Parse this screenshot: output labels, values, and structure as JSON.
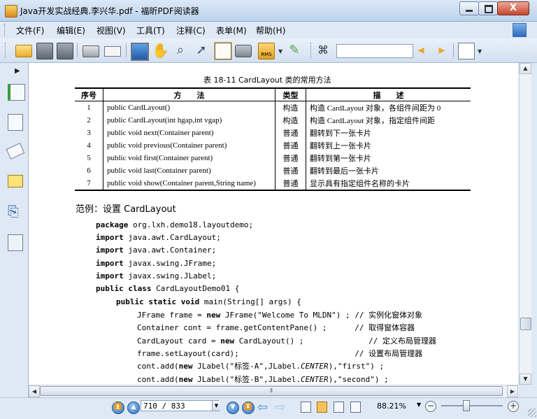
{
  "window": {
    "title": "Java开发实战经典.李兴华.pdf - 福昕PDF阅读器",
    "close_label": "X"
  },
  "menu": [
    "文件(F)",
    "编辑(E)",
    "视图(V)",
    "工具(T)",
    "注释(C)",
    "表单(M)",
    "帮助(H)"
  ],
  "toolbar": {
    "search_value": "",
    "icons": [
      "open-icon",
      "save-icon",
      "save-as-icon",
      "print-icon",
      "email-icon",
      "fullscreen-icon",
      "hand-tool-icon",
      "zoom-tool-icon",
      "select-arrow-icon",
      "text-select-icon",
      "snapshot-icon",
      "rms-icon",
      "sign-icon",
      "find-icon",
      "prev-result-icon",
      "next-result-icon",
      "doc-options-icon"
    ]
  },
  "document": {
    "table_caption": "表 18-11    CardLayout 类的常用方法",
    "table_headers": [
      "序号",
      "方　　法",
      "类型",
      "描　　述"
    ],
    "table_rows": [
      [
        "1",
        "public CardLayout()",
        "构造",
        "构造 CardLayout 对象，各组件间距为 0"
      ],
      [
        "2",
        "public CardLayout(int hgap,int vgap)",
        "构造",
        "构造 CardLayout 对象，指定组件间距"
      ],
      [
        "3",
        "public void next(Container parent)",
        "普通",
        "翻转到下一张卡片"
      ],
      [
        "4",
        "public void previous(Container parent)",
        "普通",
        "翻转到上一张卡片"
      ],
      [
        "5",
        "public void first(Container parent)",
        "普通",
        "翻转到第一张卡片"
      ],
      [
        "6",
        "public void last(Container parent)",
        "普通",
        "翻转到最后一张卡片"
      ],
      [
        "7",
        "public void show(Container parent,String name)",
        "普通",
        "显示具有指定组件名称的卡片"
      ]
    ],
    "example_heading": "范例：设置 CardLayout",
    "code": {
      "l1_kw": "package",
      "l1_rest": " org.lxh.demo18.layoutdemo;",
      "l2_kw": "import",
      "l2_rest": " java.awt.CardLayout;",
      "l3_kw": "import",
      "l3_rest": " java.awt.Container;",
      "l4_kw": "import",
      "l4_rest": " javax.swing.JFrame;",
      "l5_kw": "import",
      "l5_rest": " javax.swing.JLabel;",
      "l6_kw": "public class",
      "l6_rest": " CardLayoutDemo01 {",
      "l7_kw": "public static void",
      "l7_rest": " main(String[] args) {",
      "l8_a": "JFrame frame = ",
      "l8_kw": "new",
      "l8_b": " JFrame(\"Welcome To MLDN\") ; // 实例化窗体对象",
      "l9": "Container cont = frame.getContentPane() ;      // 取得窗体容器",
      "l10_a": "CardLayout card = ",
      "l10_kw": "new",
      "l10_b": " CardLayout() ;              // 定义布局管理器",
      "l11": "frame.setLayout(card);                         // 设置布局管理器",
      "l12_a": "cont.add(",
      "l12_kw": "new",
      "l12_b": " JLabel(\"标签-A\",JLabel.",
      "l12_it": "CENTER",
      "l12_c": "),\"first\") ;",
      "l13_a": "cont.add(",
      "l13_kw": "new",
      "l13_b": " JLabel(\"标签-B\",JLabel.",
      "l13_it": "CENTER",
      "l13_c": "),\"second\") ;"
    }
  },
  "status": {
    "page_value": "710 / 833",
    "zoom_value": "88.21%",
    "zoom_fraction": 0.4
  }
}
